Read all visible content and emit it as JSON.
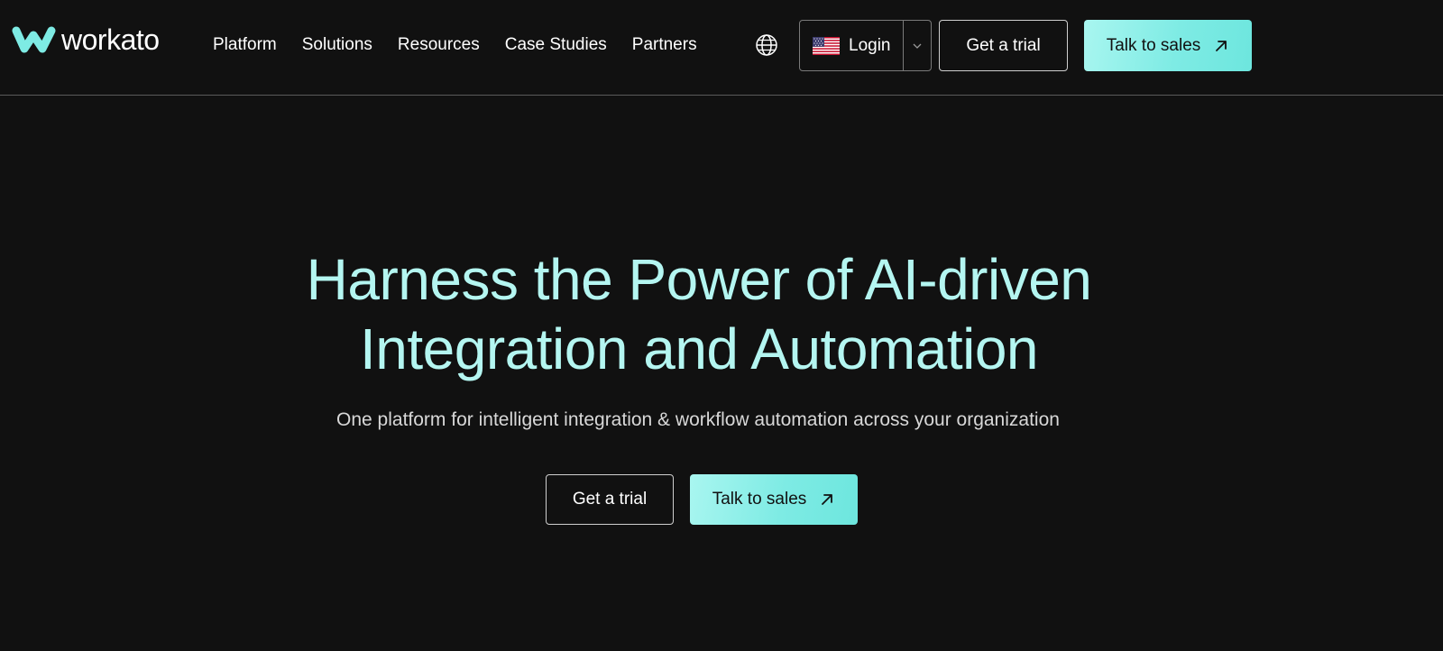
{
  "brand": {
    "name": "workato",
    "logo_icon": "workato-logo-icon",
    "accent_color": "#b4f6f1",
    "button_color": "#7eebe4",
    "background_color": "#111111"
  },
  "nav": {
    "items": [
      {
        "label": "Platform"
      },
      {
        "label": "Solutions"
      },
      {
        "label": "Resources"
      },
      {
        "label": "Case Studies"
      },
      {
        "label": "Partners"
      }
    ],
    "globe_icon": "globe-icon"
  },
  "header_actions": {
    "login_label": "Login",
    "flag_icon": "us-flag-icon",
    "dropdown_icon": "chevron-down-icon",
    "trial_label": "Get a trial",
    "sales_label": "Talk to sales",
    "arrow_icon": "arrow-up-right-icon"
  },
  "hero": {
    "title_line1": "Harness the Power of AI-driven",
    "title_line2": "Integration and Automation",
    "subtitle": "One platform for intelligent integration & workflow automation across your organization",
    "trial_label": "Get a trial",
    "sales_label": "Talk to sales"
  }
}
